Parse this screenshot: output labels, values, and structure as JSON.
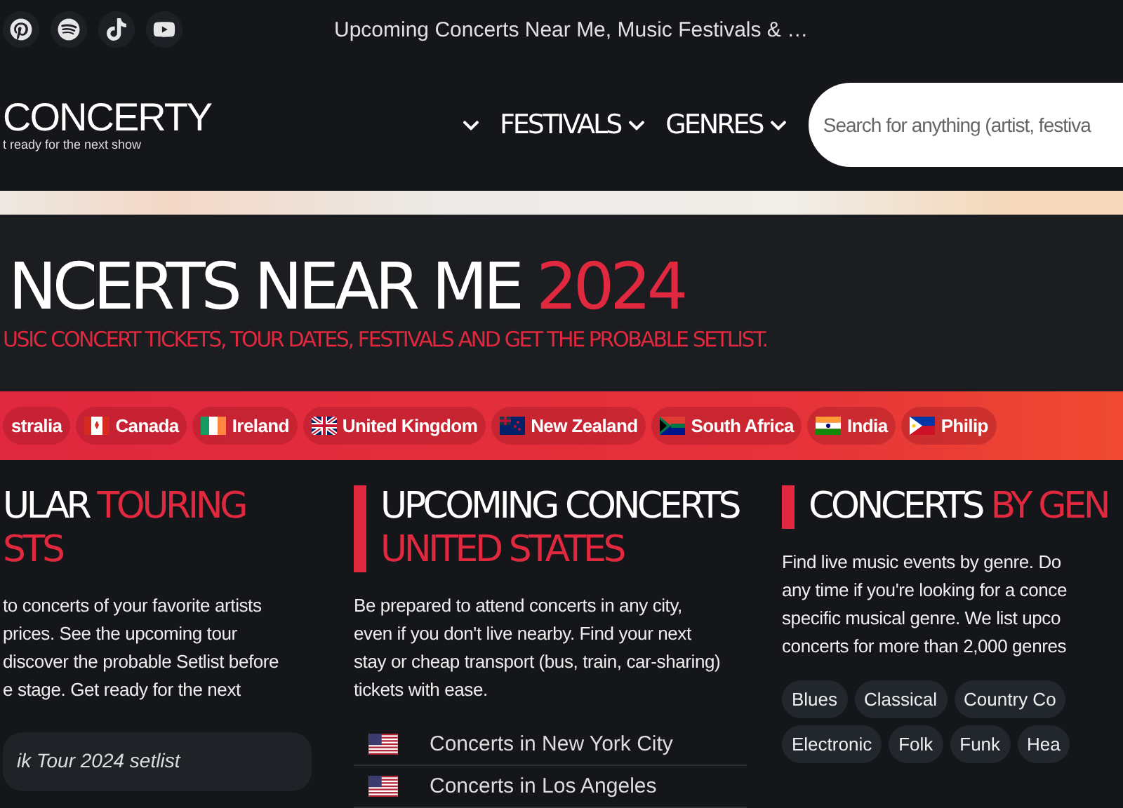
{
  "topbar": {
    "title": "Upcoming Concerts Near Me, Music Festivals & …"
  },
  "header": {
    "logo": "CONCERTY",
    "tagline": "t ready for the next show",
    "nav": [
      {
        "kind": "caret"
      },
      {
        "kind": "menu",
        "label": "FESTIVALS"
      },
      {
        "kind": "menu",
        "label": "GENRES"
      }
    ],
    "search": {
      "placeholder": "Search for anything (artist, festiva"
    }
  },
  "hero": {
    "title": "NCERTS NEAR ME",
    "year": "2024",
    "subtitle": "USIC CONCERT TICKETS, TOUR DATES, FESTIVALS AND GET THE PROBABLE SETLIST."
  },
  "countries": [
    {
      "label": "stralia",
      "kind": "none"
    },
    {
      "label": "Canada",
      "kind": "canada"
    },
    {
      "label": "Ireland",
      "kind": "ireland"
    },
    {
      "label": "United Kingdom",
      "kind": "uk"
    },
    {
      "label": "New Zealand",
      "kind": "nz"
    },
    {
      "label": "South Africa",
      "kind": "za"
    },
    {
      "label": "India",
      "kind": "india"
    },
    {
      "label": "Philip",
      "kind": "ph"
    }
  ],
  "sections": [
    {
      "title": "ULAR",
      "accent": "TOURING",
      "line2": "STS",
      "text": [
        "to concerts of your favorite artists",
        "prices. See the upcoming tour",
        "discover the probable Setlist before",
        "e stage. Get ready for the next"
      ],
      "card": "ik Tour 2024 setlist"
    },
    {
      "title": "UPCOMING CONCERTS",
      "line2": "UNITED STATES",
      "text": [
        "Be prepared to attend concerts in any city,",
        "even if you don't live nearby. Find your next",
        "stay or cheap transport (bus, train, car-sharing)",
        "tickets with ease."
      ],
      "links": [
        "Concerts in New York City",
        "Concerts in Los Angeles"
      ]
    },
    {
      "title": "CONCERTS",
      "accent": "BY GEN",
      "text": [
        "Find live music events by genre. Do",
        "any time if you're looking for a conce",
        "specific musical genre. We list upco",
        "concerts for more than 2,000 genres"
      ],
      "tags": [
        "Blues",
        "Classical",
        "Country Co",
        "Electronic",
        "Folk",
        "Funk",
        "Hea"
      ]
    }
  ]
}
